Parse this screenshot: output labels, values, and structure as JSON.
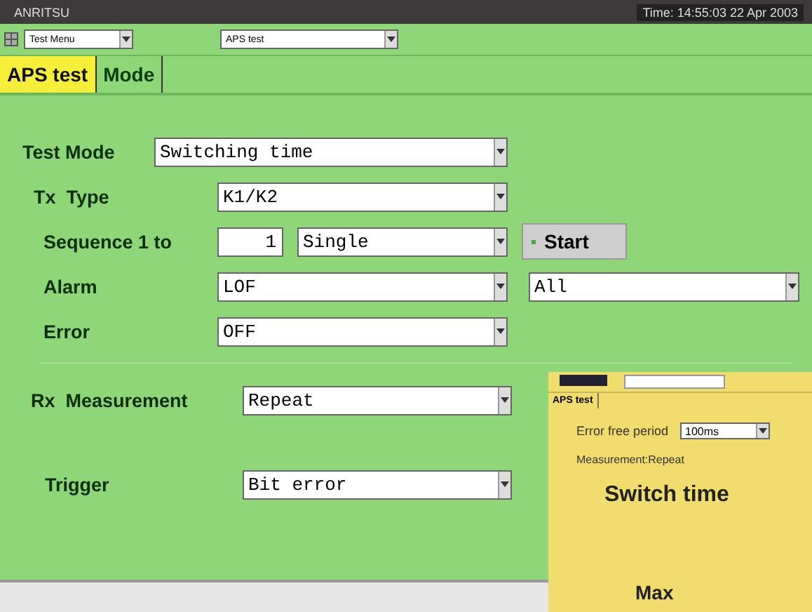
{
  "window": {
    "title": "ANRITSU",
    "clock": "Time: 14:55:03 22 Apr 2003"
  },
  "toolbar": {
    "menu_select": "Test Menu",
    "page_select": "APS test"
  },
  "tabs": [
    {
      "label": "APS test",
      "selected": true
    },
    {
      "label": "Mode",
      "selected": false
    }
  ],
  "form": {
    "test_mode": {
      "label": "Test Mode",
      "value": "Switching time"
    },
    "tx_type": {
      "label": "Tx  Type",
      "value": "K1/K2"
    },
    "sequence": {
      "label": "Sequence 1 to",
      "count": "1",
      "value": "Single",
      "button": "Start"
    },
    "alarm": {
      "label": "Alarm",
      "value": "LOF",
      "value_2": "All"
    },
    "error": {
      "label": "Error",
      "value": "OFF"
    },
    "rx_measurement": {
      "label": "Rx  Measurement",
      "value": "Repeat"
    },
    "trigger": {
      "label": "Trigger",
      "value": "Bit error"
    }
  },
  "inset": {
    "tab": "APS test",
    "period_label": "Error free period",
    "period_value": "100ms",
    "measurement": "Measurement:Repeat",
    "heading": "Switch time",
    "max_label": "Max"
  }
}
